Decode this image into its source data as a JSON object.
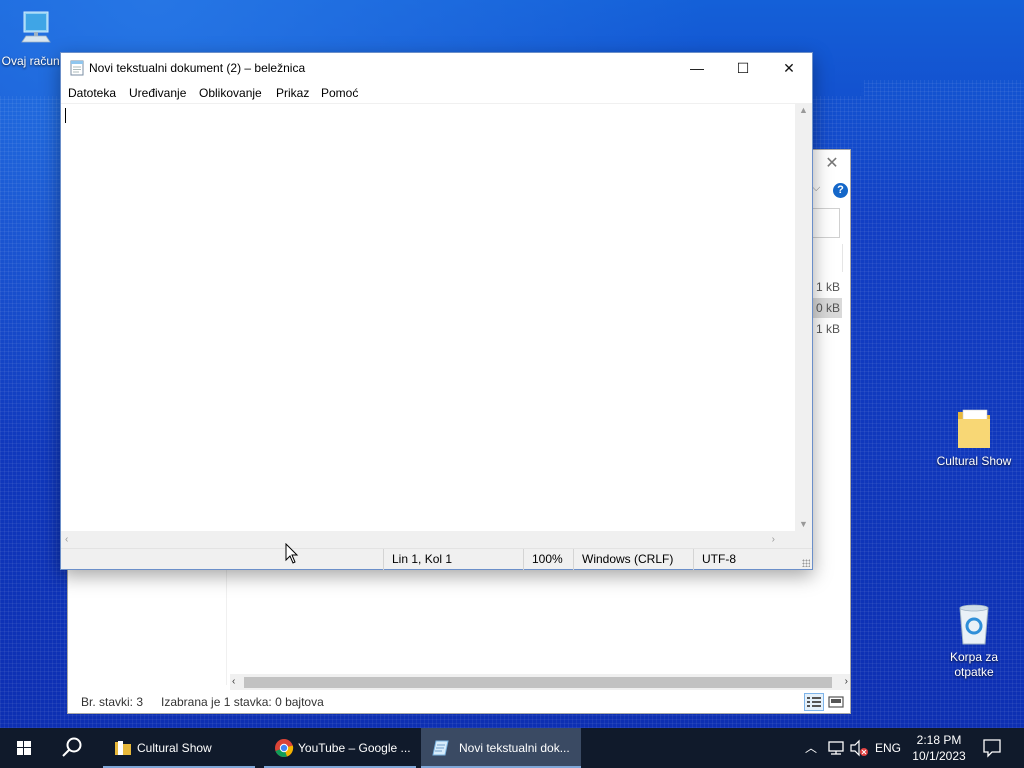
{
  "desktop": {
    "icons": [
      {
        "name": "this-pc",
        "label": "Ovaj računar"
      },
      {
        "name": "cultural-show-folder",
        "label": "Cultural Show"
      },
      {
        "name": "recycle-bin",
        "label": "Korpa za otpatke"
      }
    ]
  },
  "explorer": {
    "sizes": [
      "1 kB",
      "0 kB",
      "1 kB"
    ],
    "status_items": "Br. stavki: 3",
    "status_selected": "Izabrana je 1 stavka: 0 bajtova"
  },
  "notepad": {
    "title": "Novi tekstualni dokument (2) – beležnica",
    "menu": [
      "Datoteka",
      "Uređivanje",
      "Oblikovanje",
      "Prikaz",
      "Pomoć"
    ],
    "content": "",
    "status": {
      "position": "Lin 1, Kol 1",
      "zoom": "100%",
      "line_endings": "Windows (CRLF)",
      "encoding": "UTF-8"
    }
  },
  "taskbar": {
    "apps": [
      {
        "label": "Cultural Show",
        "icon": "folder-icon"
      },
      {
        "label": "YouTube – Google ...",
        "icon": "chrome-icon"
      },
      {
        "label": "Novi tekstualni dok...",
        "icon": "notepad-icon"
      }
    ],
    "language": "ENG",
    "time": "2:18 PM",
    "date": "10/1/2023"
  }
}
